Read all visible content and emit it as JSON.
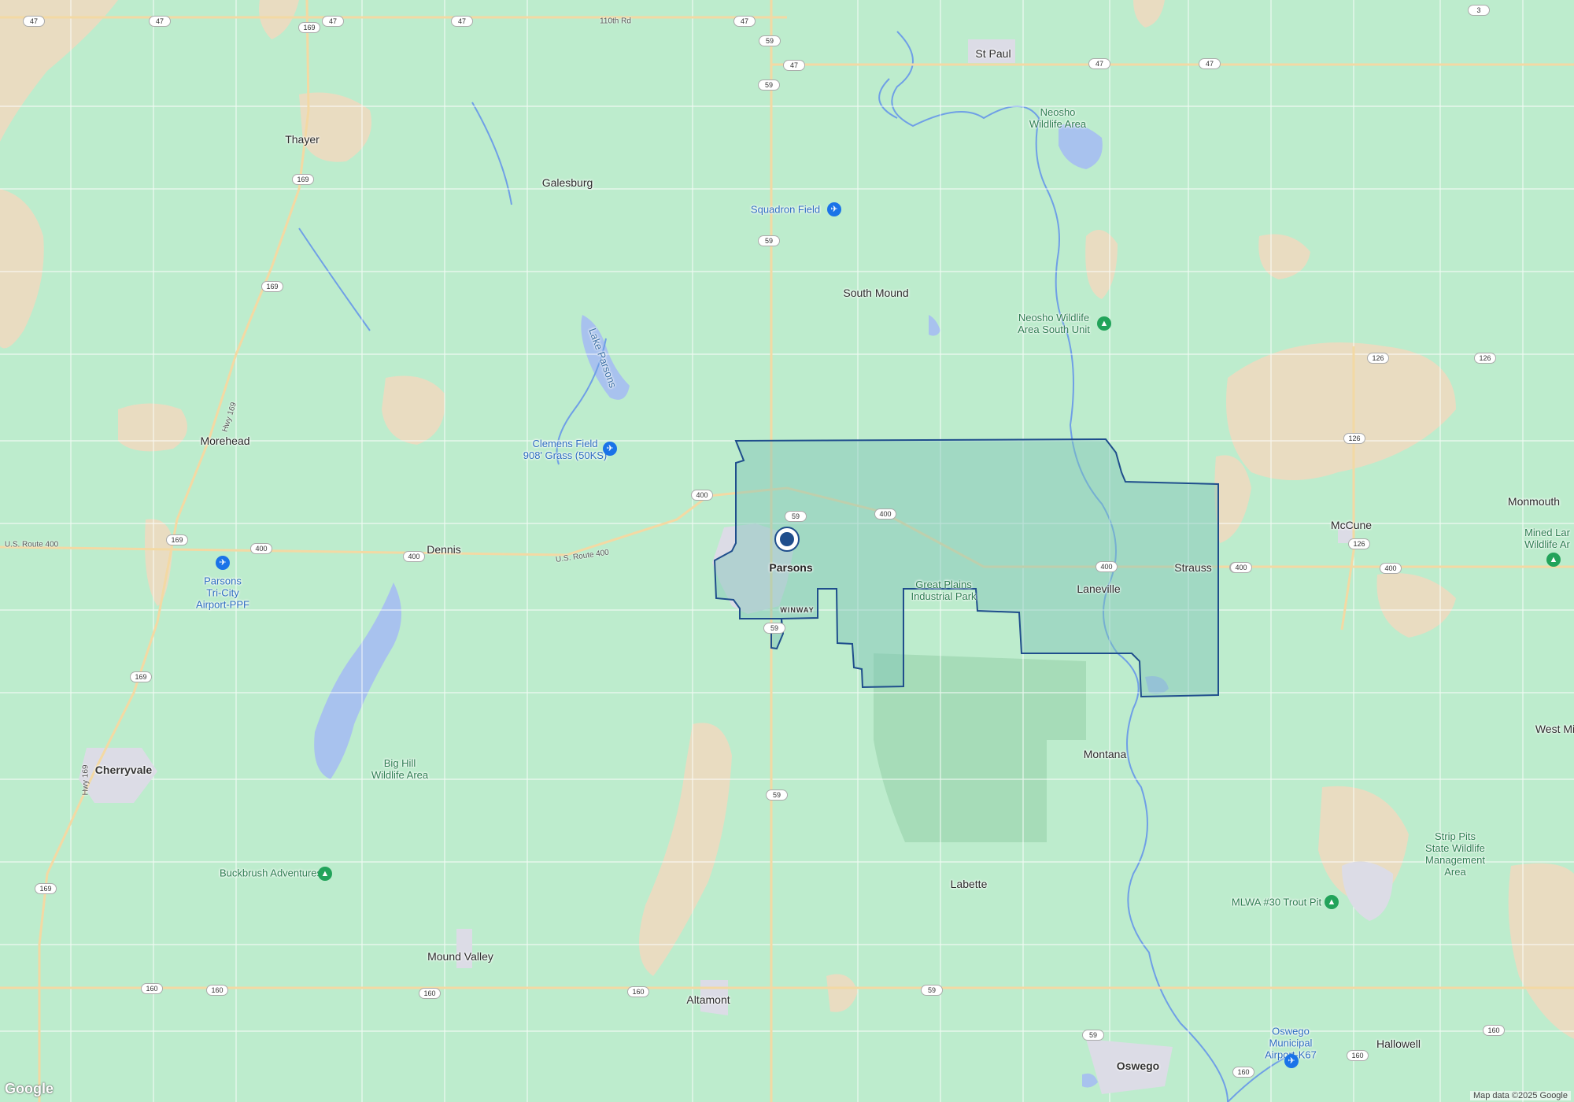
{
  "map": {
    "region_outline_color": "#1f4e8c",
    "region_fill_color": "#7fc4b8",
    "land_color": "#bdeccd",
    "farmland_color": "#e9dcc1",
    "water_color": "#a8c2ee",
    "town_color": "#dcdce6"
  },
  "places": {
    "st_paul": "St Paul",
    "thayer": "Thayer",
    "galesburg": "Galesburg",
    "south_mound": "South Mound",
    "morehead": "Morehead",
    "dennis": "Dennis",
    "parsons": "Parsons",
    "laneville": "Laneville",
    "strauss": "Strauss",
    "mccune": "McCune",
    "monmouth": "Monmouth",
    "west_mi": "West Mi",
    "montana": "Montana",
    "cherryvale": "Cherryvale",
    "labette": "Labette",
    "mound_valley": "Mound Valley",
    "altamont": "Altamont",
    "oswego": "Oswego",
    "hallowell": "Hallowell",
    "winway": "WINWAY"
  },
  "pois": {
    "neosho_wildlife": "Neosho\nWildlife Area",
    "neosho_south": "Neosho Wildlife\nArea South Unit",
    "squadron_field": "Squadron Field",
    "lake_parsons": "Lake Parsons",
    "clemens_field": "Clemens Field\n908' Grass (50KS)",
    "parsons_airport": "Parsons\nTri-City\nAirport-PPF",
    "great_plains": "Great Plains\nIndustrial Park",
    "big_hill": "Big Hill\nWildlife Area",
    "buckbrush": "Buckbrush Adventures",
    "mined_land": "Mined Lar\nWildlife Ar",
    "strip_pits": "Strip Pits\nState Wildlife\nManagement\nArea",
    "mlwa_trout": "MLWA #30 Trout Pit",
    "oswego_airport": "Oswego\nMunicipal\nAirport-K67"
  },
  "roads": {
    "r110": "110th Rd",
    "us400": "U.S. Route 400",
    "us400b": "U.S. Route 400",
    "hwy169": "Hwy 169",
    "hwy169b": "Hwy 169"
  },
  "shields": [
    "47",
    "47",
    "169",
    "47",
    "47",
    "59",
    "47",
    "47",
    "47",
    "47",
    "3",
    "169",
    "59",
    "169",
    "59",
    "400",
    "400",
    "169",
    "400",
    "400",
    "59",
    "400",
    "400",
    "126",
    "126",
    "126",
    "126",
    "400",
    "400",
    "169",
    "59",
    "59",
    "160",
    "160",
    "160",
    "160",
    "59",
    "59",
    "160",
    "160",
    "160",
    "169"
  ],
  "attribution": "Map data ©2025 Google",
  "logo": "Google"
}
